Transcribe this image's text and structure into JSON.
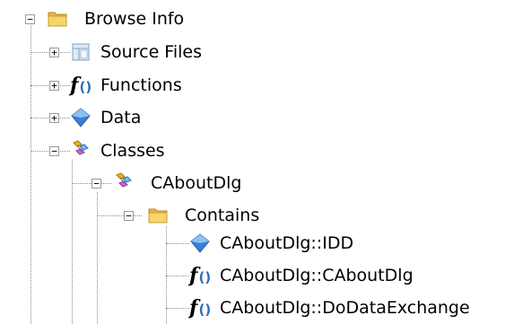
{
  "tree": {
    "root": {
      "label": "Browse Info",
      "icon": "folder-icon",
      "state": "expanded"
    },
    "children": [
      {
        "label": "Source Files",
        "icon": "source-files-icon",
        "state": "collapsed"
      },
      {
        "label": "Functions",
        "icon": "function-icon",
        "state": "collapsed"
      },
      {
        "label": "Data",
        "icon": "data-icon",
        "state": "collapsed"
      },
      {
        "label": "Classes",
        "icon": "classes-icon",
        "state": "expanded"
      }
    ],
    "class_item": {
      "label": "CAboutDlg",
      "icon": "class-icon",
      "state": "expanded"
    },
    "contains_item": {
      "label": "Contains",
      "icon": "folder-icon",
      "state": "expanded"
    },
    "members": [
      {
        "label": "CAboutDlg::IDD",
        "icon": "data-icon"
      },
      {
        "label": "CAboutDlg::CAboutDlg",
        "icon": "function-icon"
      },
      {
        "label": "CAboutDlg::DoDataExchange",
        "icon": "function-icon"
      }
    ]
  },
  "colors": {
    "folder": "#f1c95a",
    "data": "#3a7fd6",
    "function_braces": "#2f6fb6",
    "tree_lines": "#8c8c8c"
  }
}
